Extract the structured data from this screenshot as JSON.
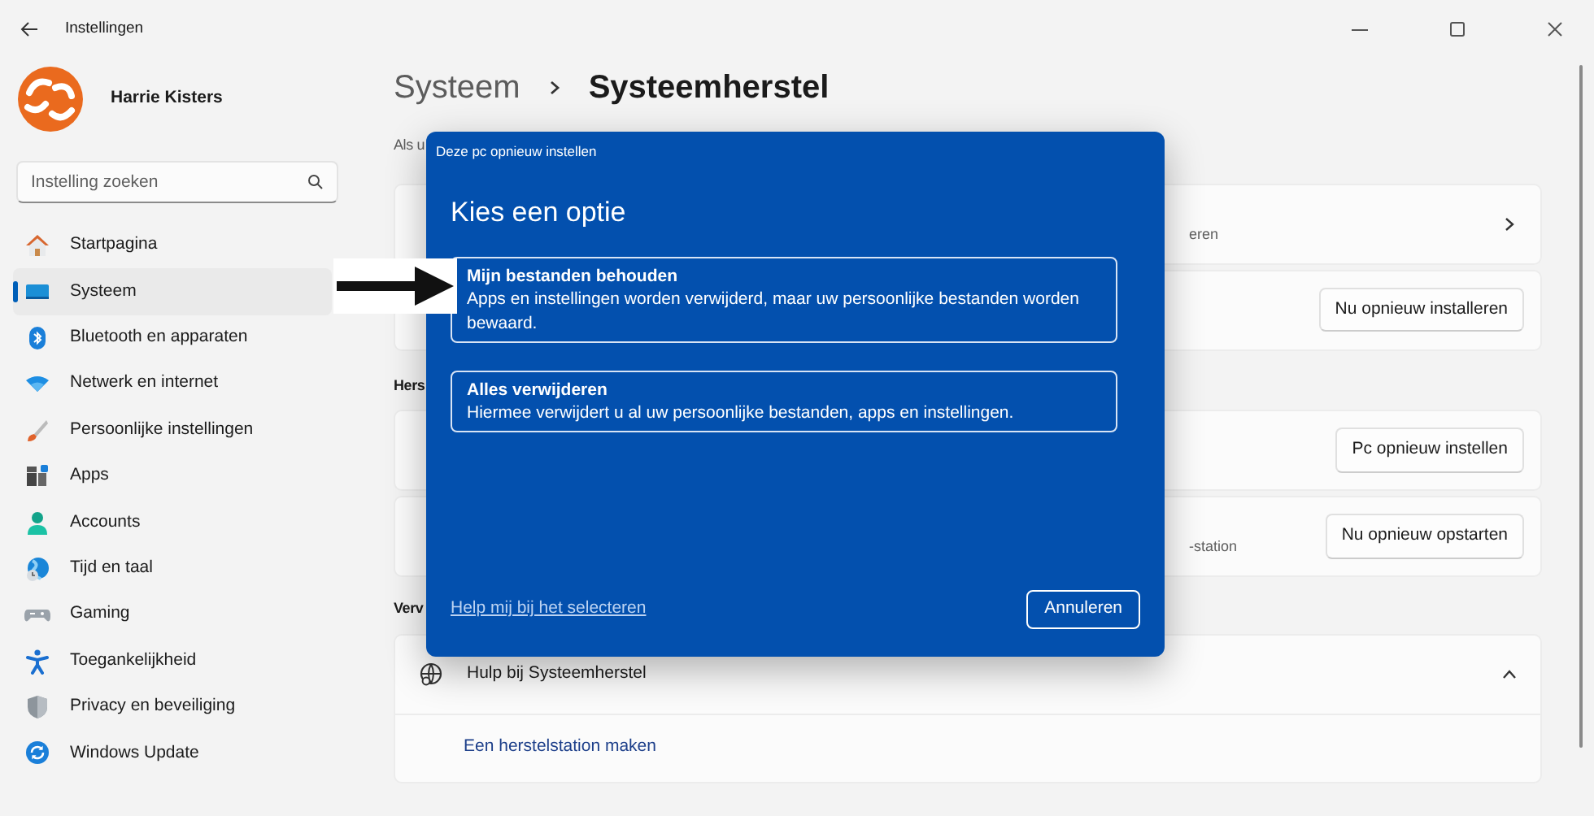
{
  "window": {
    "title": "Instellingen"
  },
  "user": {
    "name": "Harrie Kisters"
  },
  "search": {
    "placeholder": "Instelling zoeken"
  },
  "sidebar": {
    "items": [
      {
        "label": "Startpagina",
        "kind": "home",
        "selected": false
      },
      {
        "label": "Systeem",
        "kind": "system",
        "selected": true
      },
      {
        "label": "Bluetooth en apparaten",
        "kind": "bluetooth",
        "selected": false
      },
      {
        "label": "Netwerk en internet",
        "kind": "network",
        "selected": false
      },
      {
        "label": "Persoonlijke instellingen",
        "kind": "brush",
        "selected": false
      },
      {
        "label": "Apps",
        "kind": "apps",
        "selected": false
      },
      {
        "label": "Accounts",
        "kind": "account",
        "selected": false
      },
      {
        "label": "Tijd en taal",
        "kind": "time",
        "selected": false
      },
      {
        "label": "Gaming",
        "kind": "gaming",
        "selected": false
      },
      {
        "label": "Toegankelijkheid",
        "kind": "access",
        "selected": false
      },
      {
        "label": "Privacy en beveiliging",
        "kind": "shield",
        "selected": false
      },
      {
        "label": "Windows Update",
        "kind": "update",
        "selected": false
      }
    ]
  },
  "breadcrumb": [
    "Systeem",
    "Systeemherstel"
  ],
  "sections": [
    {
      "kind": "intro",
      "heading": "Als u",
      "cards": [
        {
          "kind": "link",
          "subtitle": "eren"
        },
        {
          "kind": "button",
          "button": "Nu opnieuw installeren"
        }
      ]
    },
    {
      "kind": "heading",
      "heading": "Hers",
      "cards": [
        {
          "kind": "button",
          "button": "Pc opnieuw instellen"
        },
        {
          "kind": "button",
          "subtitle": "-station",
          "button": "Nu opnieuw opstarten"
        }
      ]
    },
    {
      "kind": "heading",
      "heading": "Verv",
      "cards": [
        {
          "kind": "expandable",
          "title": "Hulp bij Systeemherstel",
          "expanded": true,
          "links": [
            "Een herstelstation maken"
          ]
        }
      ]
    }
  ],
  "dialog": {
    "title": "Deze pc opnieuw instellen",
    "heading": "Kies een optie",
    "options": [
      {
        "title": "Mijn bestanden behouden",
        "description": "Apps en instellingen worden verwijderd, maar uw persoonlijke bestanden worden bewaard."
      },
      {
        "title": "Alles verwijderen",
        "description": "Hiermee verwijdert u al uw persoonlijke bestanden, apps en instellingen."
      }
    ],
    "help_link": "Help mij bij het selecteren",
    "cancel_button": "Annuleren"
  }
}
